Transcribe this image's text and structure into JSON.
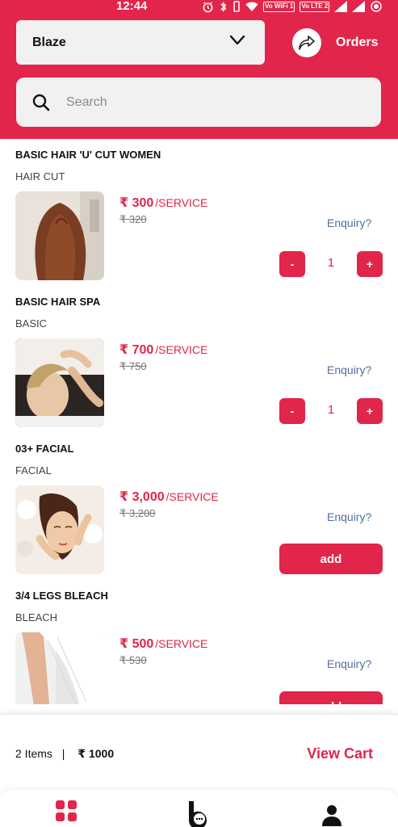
{
  "statusbar": {
    "time": "12:44",
    "vowifi": "Vo WiFi 1",
    "volte": "Vo LTE 2"
  },
  "header": {
    "store_select": {
      "value": "Blaze"
    },
    "orders_label": "Orders",
    "search": {
      "placeholder": "Search"
    }
  },
  "products": [
    {
      "name": "BASIC HAIR 'U' CUT WOMEN",
      "category": "HAIR CUT",
      "price": "₹ 300",
      "unit": "/SERVICE",
      "mrp": "₹ 320",
      "enquiry": "Enquiry?",
      "quantity": "1",
      "minus": "-",
      "plus": "+"
    },
    {
      "name": "BASIC HAIR SPA",
      "category": "BASIC",
      "price": "₹ 700",
      "unit": "/SERVICE",
      "mrp": "₹ 750",
      "enquiry": "Enquiry?",
      "quantity": "1",
      "minus": "-",
      "plus": "+"
    },
    {
      "name": "03+ FACIAL",
      "category": "FACIAL",
      "price": "₹ 3,000",
      "unit": "/SERVICE",
      "mrp": "₹ 3,200",
      "enquiry": "Enquiry?",
      "add_label": "add"
    },
    {
      "name": "3/4 LEGS BLEACH",
      "category": "BLEACH",
      "price": "₹ 500",
      "unit": "/SERVICE",
      "mrp": "₹ 530",
      "enquiry": "Enquiry?",
      "add_label": "add"
    }
  ],
  "cart": {
    "items_text": "2 Items",
    "separator": "|",
    "total": "₹ 1000",
    "view_cart_label": "View Cart"
  },
  "bottom_nav": {
    "items": [
      "dashboard-icon",
      "brand-logo-icon",
      "profile-icon"
    ]
  },
  "colors": {
    "accent": "#e2254a",
    "link": "#4f6ea0"
  }
}
